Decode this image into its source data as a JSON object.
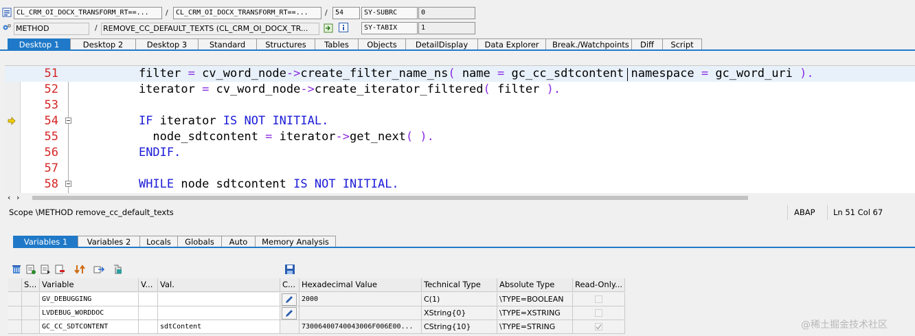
{
  "header": {
    "program1": "CL_CRM_OI_DOCX_TRANSFORM_RT==...",
    "program2": "CL_CRM_OI_DOCX_TRANSFORM_RT==...",
    "line_no": "54",
    "sy_subrc_label": "SY-SUBRC",
    "sy_subrc_value": "0",
    "event_type": "METHOD",
    "event_name": "REMOVE_CC_DEFAULT_TEXTS (CL_CRM_OI_DOCX_TR...",
    "sy_tabix_label": "SY-TABIX",
    "sy_tabix_value": "1",
    "slash": "/"
  },
  "desktop_tabs": [
    "Desktop 1",
    "Desktop 2",
    "Desktop 3",
    "Standard",
    "Structures",
    "Tables",
    "Objects",
    "DetailDisplay",
    "Data Explorer",
    "Break./Watchpoints",
    "Diff",
    "Script"
  ],
  "code": {
    "lines": [
      {
        "num": "51",
        "parts": [
          {
            "t": "    filter ",
            "c": ""
          },
          {
            "t": "=",
            "c": "op"
          },
          {
            "t": " cv_word_node",
            "c": ""
          },
          {
            "t": "->",
            "c": "op"
          },
          {
            "t": "create_filter_name_ns",
            "c": ""
          },
          {
            "t": "(",
            "c": "op"
          },
          {
            "t": " name ",
            "c": ""
          },
          {
            "t": "=",
            "c": "op"
          },
          {
            "t": " gc_cc_sdtcontent namespace ",
            "c": ""
          },
          {
            "t": "=",
            "c": "op"
          },
          {
            "t": " gc_word_uri ",
            "c": ""
          },
          {
            "t": ").",
            "c": "op"
          }
        ]
      },
      {
        "num": "52",
        "parts": [
          {
            "t": "    iterator ",
            "c": ""
          },
          {
            "t": "=",
            "c": "op"
          },
          {
            "t": " cv_word_node",
            "c": ""
          },
          {
            "t": "->",
            "c": "op"
          },
          {
            "t": "create_iterator_filtered",
            "c": ""
          },
          {
            "t": "(",
            "c": "op"
          },
          {
            "t": " filter ",
            "c": ""
          },
          {
            "t": ").",
            "c": "op"
          }
        ]
      },
      {
        "num": "53",
        "parts": []
      },
      {
        "num": "54",
        "parts": [
          {
            "t": "    ",
            "c": ""
          },
          {
            "t": "IF",
            "c": "kw"
          },
          {
            "t": " iterator ",
            "c": ""
          },
          {
            "t": "IS NOT INITIAL.",
            "c": "kw"
          }
        ]
      },
      {
        "num": "55",
        "parts": [
          {
            "t": "      node_sdtcontent ",
            "c": ""
          },
          {
            "t": "=",
            "c": "op"
          },
          {
            "t": " iterator",
            "c": ""
          },
          {
            "t": "->",
            "c": "op"
          },
          {
            "t": "get_next",
            "c": ""
          },
          {
            "t": "(",
            "c": "op"
          },
          {
            "t": " ",
            "c": ""
          },
          {
            "t": ").",
            "c": "op"
          }
        ]
      },
      {
        "num": "56",
        "parts": [
          {
            "t": "    ",
            "c": ""
          },
          {
            "t": "ENDIF.",
            "c": "kw"
          }
        ]
      },
      {
        "num": "57",
        "parts": []
      },
      {
        "num": "58",
        "parts": [
          {
            "t": "    ",
            "c": ""
          },
          {
            "t": "WHILE",
            "c": "kw"
          },
          {
            "t": " node sdtcontent ",
            "c": ""
          },
          {
            "t": "IS NOT INITIAL.",
            "c": "kw"
          }
        ]
      }
    ]
  },
  "status_bar": {
    "scope": "Scope \\METHOD remove_cc_default_texts",
    "language": "ABAP",
    "position": "Ln  51 Col  67"
  },
  "variable_tabs": [
    "Variables 1",
    "Variables 2",
    "Locals",
    "Globals",
    "Auto",
    "Memory Analysis"
  ],
  "grid": {
    "columns": [
      "S...",
      "Variable",
      "V...",
      "Val.",
      "C...",
      "Hexadecimal Value",
      "Technical Type",
      "Absolute Type",
      "Read-Only..."
    ],
    "rows": [
      {
        "variable": "GV_DEBUGGING",
        "value": "",
        "hex": "2000",
        "tech": "C(1)",
        "abs": "\\TYPE=BOOLEAN",
        "edit": true,
        "readonly": false
      },
      {
        "variable": "LVDEBUG_WORDDOC",
        "value": "",
        "hex": "",
        "tech": "XString{0}",
        "abs": "\\TYPE=XSTRING",
        "edit": true,
        "readonly": false
      },
      {
        "variable": "GC_CC_SDTCONTENT",
        "value": "sdtContent",
        "hex": "73006400740043006F006E00...",
        "tech": "CString{10}",
        "abs": "\\TYPE=STRING",
        "edit": false,
        "readonly": true
      }
    ]
  },
  "watermark": "@稀土掘金技术社区"
}
